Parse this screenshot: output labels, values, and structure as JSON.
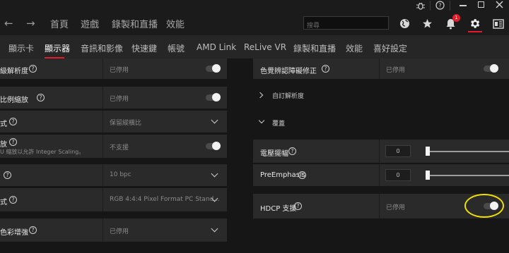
{
  "topbar": {
    "nav_back": "←",
    "nav_forward": "→",
    "links": [
      "首頁",
      "遊戲",
      "錄製和直播",
      "效能"
    ],
    "search_placeholder": "搜尋",
    "notification_count": "1",
    "icons": [
      "bug-icon",
      "help-icon",
      "minimize-icon",
      "maximize-icon",
      "close-icon",
      "globe-icon",
      "star-icon",
      "bell-icon",
      "gear-icon",
      "layout-icon"
    ]
  },
  "tabs": [
    "顯示卡",
    "顯示器",
    "音訊和影像",
    "快速鍵",
    "帳號",
    "AMD Link",
    "ReLive VR",
    "錄製和直播",
    "效能",
    "喜好設定"
  ],
  "active_tab": "顯示器",
  "left_settings": [
    {
      "label": "級解析度",
      "value": "已停用",
      "control": "toggle"
    },
    {
      "label": "比例縮放",
      "value": "已停用",
      "control": "toggle"
    },
    {
      "label": "式",
      "value": "保留縱橫比",
      "control": "dropdown"
    },
    {
      "label": "放",
      "sublabel": "U 縮放以允許 Integer Scaling。",
      "value": "不支援",
      "control": "toggle"
    },
    {
      "label": "",
      "value": "10 bpc",
      "control": "dropdown"
    },
    {
      "label": "式",
      "value": "RGB 4:4:4 Pixel Format PC Stand...",
      "control": "dropdown"
    },
    {
      "label": "色彩增強",
      "value": "已停用",
      "control": "dropdown"
    }
  ],
  "right_settings": {
    "color_row": {
      "label": "色覺辨認障礙修正",
      "value": "已停用"
    },
    "custom_resolution": "自訂解析度",
    "overrides": "覆蓋",
    "voltage_swing": {
      "label": "電壓擺幅",
      "value": "0"
    },
    "pre_emphasis": {
      "label": "PreEmphasis",
      "value": "0"
    },
    "hdcp": {
      "label": "HDCP 支援",
      "value": "已停用"
    }
  },
  "colors": {
    "accent": "#e31c2c",
    "highlight": "#f0e000",
    "panel": "#2a2a2a",
    "background": "#161616"
  }
}
